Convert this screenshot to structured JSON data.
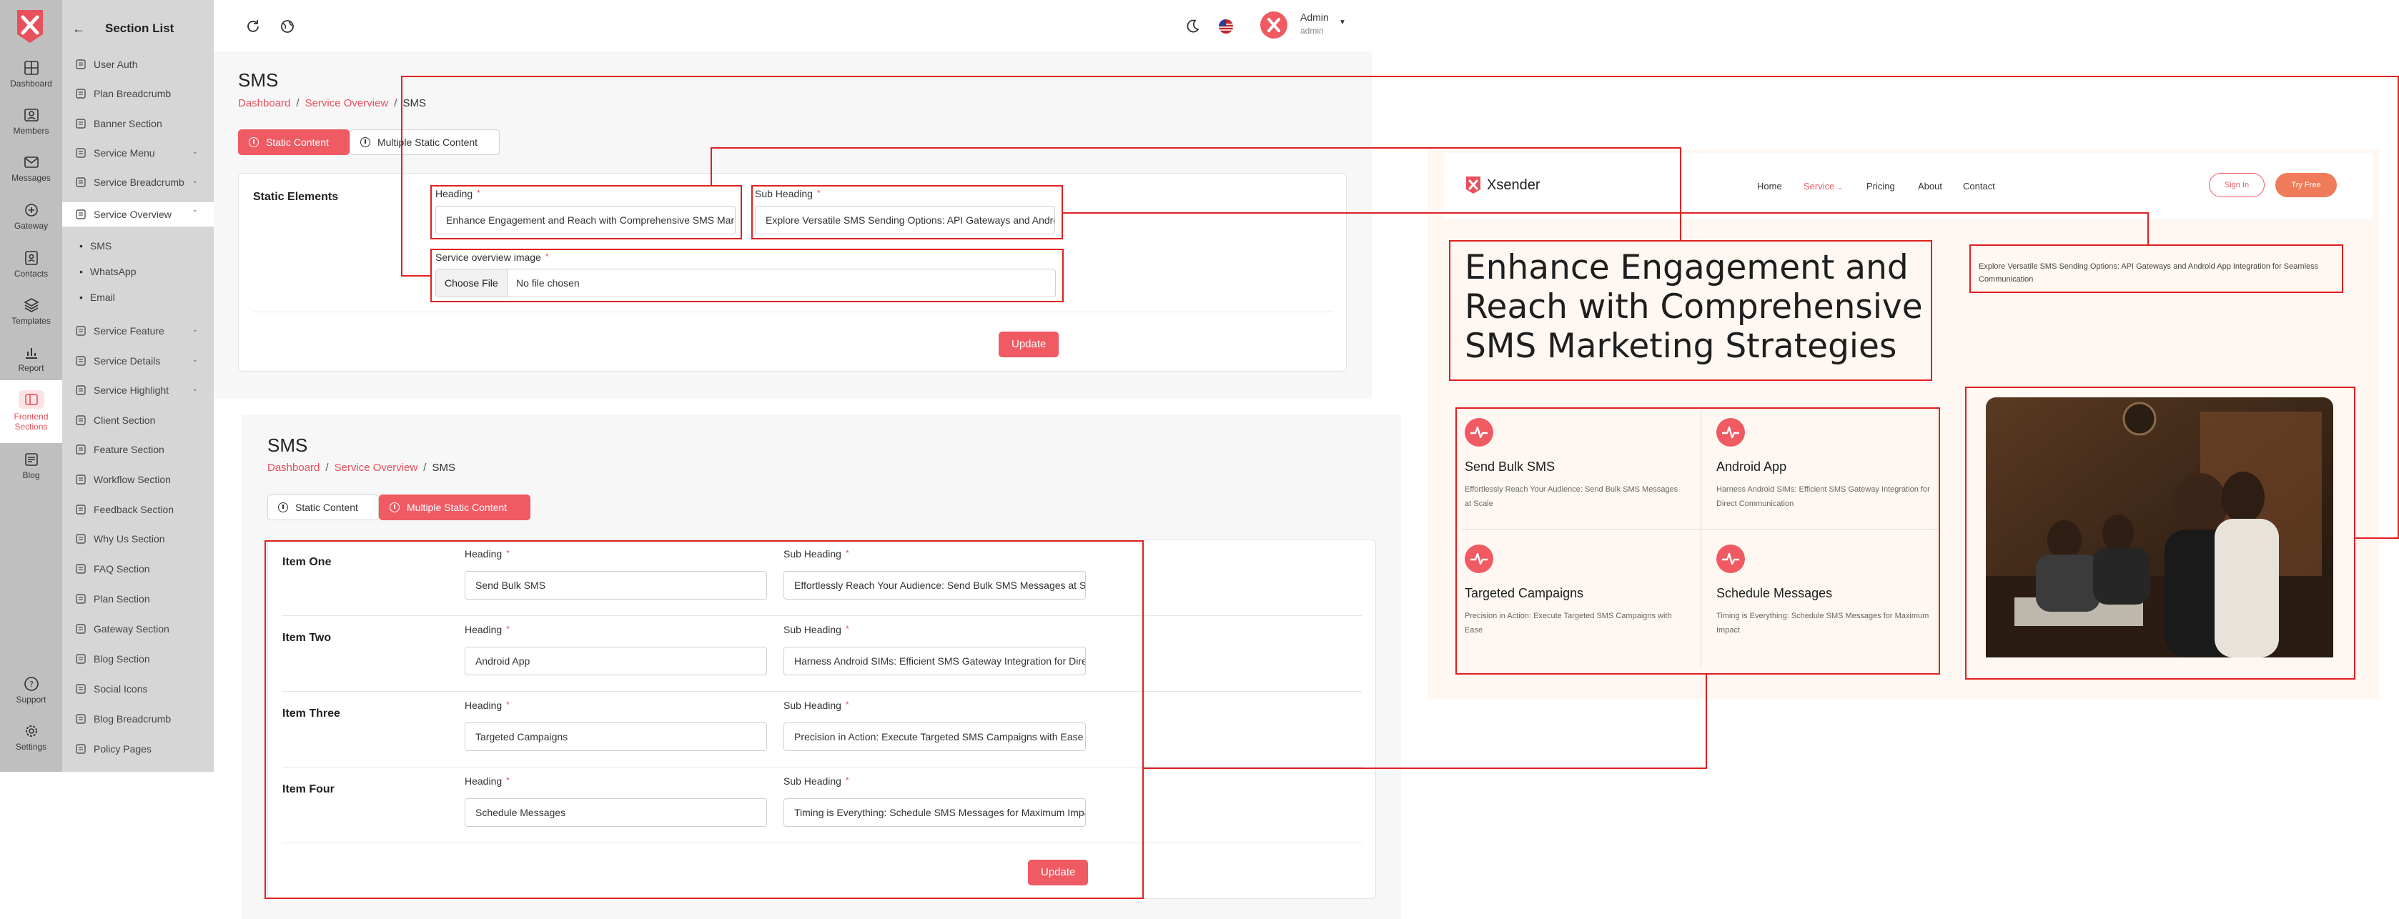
{
  "rail": {
    "items": [
      {
        "label": "Dashboard",
        "icon": "dashboard-icon"
      },
      {
        "label": "Members",
        "icon": "members-icon"
      },
      {
        "label": "Messages",
        "icon": "messages-icon"
      },
      {
        "label": "Gateway",
        "icon": "gateway-icon"
      },
      {
        "label": "Contacts",
        "icon": "contacts-icon"
      },
      {
        "label": "Templates",
        "icon": "templates-icon"
      },
      {
        "label": "Report",
        "icon": "report-icon"
      },
      {
        "label": "Frontend",
        "label2": "Sections",
        "icon": "frontend-sections-icon"
      },
      {
        "label": "Blog",
        "icon": "blog-icon"
      }
    ],
    "support": "Support",
    "settings": "Settings"
  },
  "section_list": {
    "title": "Section List",
    "items": [
      {
        "label": "User Auth"
      },
      {
        "label": "Plan Breadcrumb"
      },
      {
        "label": "Banner Section"
      },
      {
        "label": "Service Menu"
      },
      {
        "label": "Service Breadcrumb"
      },
      {
        "label": "Service Overview"
      },
      {
        "label": "Service Feature"
      },
      {
        "label": "Service Details"
      },
      {
        "label": "Service Highlight"
      },
      {
        "label": "Client Section"
      },
      {
        "label": "Feature Section"
      },
      {
        "label": "Workflow Section"
      },
      {
        "label": "Feedback Section"
      },
      {
        "label": "Why Us Section"
      },
      {
        "label": "FAQ Section"
      },
      {
        "label": "Plan Section"
      },
      {
        "label": "Gateway Section"
      },
      {
        "label": "Blog Section"
      },
      {
        "label": "Social Icons"
      },
      {
        "label": "Blog Breadcrumb"
      },
      {
        "label": "Policy Pages"
      }
    ],
    "sub_items": [
      "SMS",
      "WhatsApp",
      "Email"
    ]
  },
  "topbar": {
    "admin_name": "Admin",
    "admin_role": "admin"
  },
  "form1": {
    "title": "SMS",
    "breadcrumb": [
      "Dashboard",
      "Service Overview",
      "SMS"
    ],
    "tabs": [
      "Static Content",
      "Multiple Static Content"
    ],
    "section_label": "Static Elements",
    "heading_label": "Heading",
    "heading_value": "Enhance Engagement and Reach with Comprehensive SMS Marketing Strategies",
    "subheading_label": "Sub Heading",
    "subheading_value": "Explore Versatile SMS Sending Options: API Gateways and Android App Integration for Seamless Communication",
    "image_label": "Service overview image",
    "choose_file": "Choose File",
    "no_file": "No file chosen",
    "update": "Update"
  },
  "form2": {
    "title": "SMS",
    "breadcrumb": [
      "Dashboard",
      "Service Overview",
      "SMS"
    ],
    "tabs": [
      "Static Content",
      "Multiple Static Content"
    ],
    "heading_label": "Heading",
    "subheading_label": "Sub Heading",
    "items": [
      {
        "title": "Item One",
        "heading": "Send Bulk SMS",
        "sub": "Effortlessly Reach Your Audience: Send Bulk SMS Messages at Scale"
      },
      {
        "title": "Item Two",
        "heading": "Android App",
        "sub": "Harness Android SIMs: Efficient SMS Gateway Integration for Direct Communication"
      },
      {
        "title": "Item Three",
        "heading": "Targeted Campaigns",
        "sub": "Precision in Action: Execute Targeted SMS Campaigns with Ease"
      },
      {
        "title": "Item Four",
        "heading": "Schedule Messages",
        "sub": "Timing is Everything: Schedule SMS Messages for Maximum Impact"
      }
    ],
    "update": "Update"
  },
  "preview": {
    "brand": "Xsender",
    "nav": [
      "Home",
      "Service",
      "Pricing",
      "About",
      "Contact"
    ],
    "sign_in": "Sign In",
    "try_free": "Try Free",
    "hero_lines": [
      "Enhance Engagement and",
      "Reach with Comprehensive",
      "SMS Marketing Strategies"
    ],
    "subheading": "Explore Versatile SMS Sending Options: API Gateways and Android App Integration for Seamless Communication",
    "features": [
      {
        "title": "Send Bulk SMS",
        "desc": "Effortlessly Reach Your Audience: Send Bulk SMS Messages at Scale"
      },
      {
        "title": "Android App",
        "desc": "Harness Android SIMs: Efficient SMS Gateway Integration for Direct Communication"
      },
      {
        "title": "Targeted Campaigns",
        "desc": "Precision in Action: Execute Targeted SMS Campaigns with Ease"
      },
      {
        "title": "Schedule Messages",
        "desc": "Timing is Everything: Schedule SMS Messages for Maximum Impact"
      }
    ]
  },
  "colors": {
    "accent": "#ef5a63",
    "annotation": "#e02020",
    "rail_bg": "#bfbfbf",
    "panel_bg": "#d6d6d6"
  }
}
